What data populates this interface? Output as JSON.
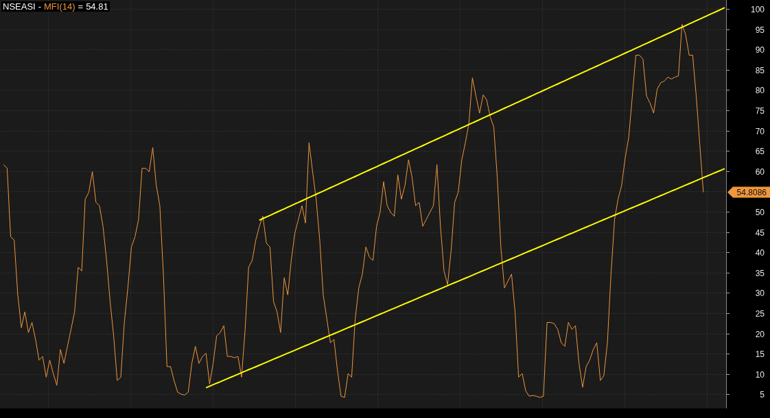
{
  "chart": {
    "title": {
      "symbol": "NSEASI",
      "separator": "-",
      "equals": "=",
      "value": "54.81"
    },
    "last_value": "54.8086",
    "chart_data": {
      "type": "line",
      "ylim": [
        1.5,
        102.2
      ],
      "grid": true,
      "yticks": [
        5,
        10,
        15,
        20,
        25,
        30,
        35,
        40,
        45,
        50,
        60,
        65,
        70,
        75,
        80,
        85,
        90,
        95,
        100
      ],
      "series": [
        {
          "name": "MFI(14)",
          "color": "#f0963c",
          "values": [
            61.6,
            60.7,
            43.8,
            43.0,
            29.5,
            21.4,
            25.3,
            20.2,
            22.7,
            18.5,
            13.4,
            14.3,
            9.2,
            13.4,
            10.1,
            7.2,
            16.0,
            12.6,
            16.8,
            21.0,
            25.3,
            36.3,
            35.4,
            53.1,
            54.8,
            59.9,
            52.3,
            51.5,
            46.4,
            38.0,
            27.8,
            19.4,
            8.4,
            9.2,
            22.7,
            31.2,
            41.3,
            43.8,
            48.1,
            60.7,
            60.7,
            59.9,
            65.8,
            56.5,
            51.5,
            34.6,
            11.8,
            11.8,
            8.4,
            5.5,
            5.0,
            4.8,
            5.5,
            12.6,
            16.8,
            12.6,
            14.3,
            15.1,
            7.5,
            12.6,
            19.4,
            20.2,
            21.9,
            14.3,
            14.3,
            14.0,
            14.3,
            9.2,
            21.0,
            36.3,
            38.0,
            43.0,
            46.4,
            48.9,
            42.2,
            41.3,
            27.8,
            25.3,
            20.2,
            33.7,
            29.5,
            38.0,
            44.7,
            48.1,
            51.5,
            47.2,
            67.0,
            59.9,
            53.1,
            43.0,
            29.5,
            23.6,
            17.7,
            18.5,
            10.9,
            4.5,
            4.2,
            10.1,
            9.2,
            23.6,
            31.2,
            34.6,
            41.3,
            38.8,
            38.0,
            46.4,
            49.8,
            57.4,
            51.5,
            49.8,
            48.9,
            59.1,
            53.1,
            56.5,
            62.8,
            58.5,
            51.5,
            52.3,
            46.4,
            48.1,
            49.8,
            51.5,
            61.6,
            46.4,
            35.4,
            32.0,
            40.5,
            52.3,
            54.8,
            62.8,
            67.0,
            71.7,
            83.0,
            78.5,
            74.3,
            78.8,
            77.6,
            73.4,
            70.9,
            58.2,
            41.3,
            31.2,
            32.9,
            34.6,
            25.3,
            9.2,
            10.1,
            5.8,
            4.5,
            4.7,
            4.5,
            4.2,
            4.5,
            22.7,
            22.7,
            22.4,
            21.0,
            17.7,
            16.8,
            22.7,
            21.0,
            21.9,
            12.6,
            6.7,
            11.8,
            13.4,
            16.0,
            17.7,
            8.4,
            9.6,
            17.7,
            34.6,
            48.1,
            53.1,
            56.5,
            63.3,
            68.4,
            78.5,
            88.6,
            88.6,
            87.6,
            78.5,
            76.8,
            74.3,
            80.2,
            81.8,
            82.2,
            83.2,
            82.7,
            83.2,
            83.5,
            96.2,
            93.7,
            88.6,
            88.6,
            78.5,
            66.6,
            54.8,
            null,
            null,
            null,
            null,
            null,
            null
          ]
        },
        {
          "color": "#ffff00",
          "values": [
            null,
            null,
            null,
            null,
            null,
            null,
            null,
            null,
            null,
            null,
            null,
            null,
            null,
            null,
            null,
            null,
            null,
            null,
            null,
            null,
            null,
            null,
            null,
            null,
            null,
            null,
            null,
            null,
            null,
            null,
            null,
            null,
            null,
            null,
            null,
            null,
            null,
            null,
            null,
            null,
            null,
            null,
            null,
            null,
            null,
            null,
            null,
            null,
            null,
            null,
            null,
            null,
            null,
            null,
            null,
            null,
            null,
            null,
            null,
            null,
            null,
            null,
            null,
            null,
            null,
            null,
            null,
            null,
            null,
            null,
            null,
            null,
            47.9,
            48.3,
            48.7,
            49.1,
            49.5,
            49.9,
            50.3,
            50.7,
            51.1,
            51.5,
            51.9,
            52.3,
            52.7,
            53.1,
            53.5,
            53.9,
            54.3,
            54.7,
            55.1,
            55.5,
            55.9,
            56.3,
            56.7,
            57.1,
            57.5,
            57.9,
            58.3,
            58.7,
            59.1,
            59.5,
            59.9,
            60.3,
            60.7,
            61.1,
            61.5,
            61.9,
            62.3,
            62.7,
            63.1,
            63.5,
            63.9,
            64.3,
            64.7,
            65.1,
            65.5,
            65.9,
            66.3,
            66.7,
            67.1,
            67.5,
            67.9,
            68.3,
            68.7,
            69.1,
            69.5,
            69.9,
            70.3,
            70.7,
            71.1,
            71.5,
            71.9,
            72.3,
            72.7,
            73.1,
            73.5,
            73.9,
            74.3,
            74.7,
            75.1,
            75.5,
            75.9,
            76.3,
            76.7,
            77.1,
            77.5,
            77.9,
            78.3,
            78.7,
            79.1,
            79.5,
            79.9,
            80.3,
            80.7,
            81.1,
            81.5,
            81.9,
            82.3,
            82.7,
            83.1,
            83.5,
            83.9,
            84.3,
            84.7,
            85.1,
            85.5,
            85.9,
            86.3,
            86.7,
            87.1,
            87.5,
            87.9,
            88.3,
            88.7,
            89.1,
            89.5,
            89.9,
            90.3,
            90.7,
            91.1,
            91.5,
            91.9,
            92.3,
            92.7,
            93.1,
            93.5,
            93.9,
            94.3,
            94.7,
            95.1,
            95.5,
            95.9,
            96.3,
            96.7,
            97.1,
            97.5,
            97.9,
            98.3,
            98.7,
            99.1,
            99.5,
            99.9,
            100.3
          ]
        },
        {
          "color": "#ffff00",
          "values": [
            null,
            null,
            null,
            null,
            null,
            null,
            null,
            null,
            null,
            null,
            null,
            null,
            null,
            null,
            null,
            null,
            null,
            null,
            null,
            null,
            null,
            null,
            null,
            null,
            null,
            null,
            null,
            null,
            null,
            null,
            null,
            null,
            null,
            null,
            null,
            null,
            null,
            null,
            null,
            null,
            null,
            null,
            null,
            null,
            null,
            null,
            null,
            null,
            null,
            null,
            null,
            null,
            null,
            null,
            null,
            null,
            null,
            6.6,
            6.97,
            7.34,
            7.71,
            8.08,
            8.45,
            8.82,
            9.19,
            9.56,
            9.93,
            10.3,
            10.67,
            11.04,
            11.41,
            11.78,
            12.15,
            12.52,
            12.89,
            13.26,
            13.63,
            14,
            14.37,
            14.74,
            15.11,
            15.48,
            15.85,
            16.22,
            16.59,
            16.96,
            17.33,
            17.7,
            18.07,
            18.44,
            18.81,
            19.18,
            19.55,
            19.92,
            20.29,
            20.66,
            21.03,
            21.4,
            21.77,
            22.14,
            22.51,
            22.88,
            23.25,
            23.62,
            23.99,
            24.36,
            24.73,
            25.1,
            25.47,
            25.84,
            26.21,
            26.58,
            26.95,
            27.32,
            27.69,
            28.06,
            28.43,
            28.8,
            29.17,
            29.54,
            29.91,
            30.28,
            30.65,
            31.02,
            31.39,
            31.76,
            32.13,
            32.5,
            32.87,
            33.24,
            33.61,
            33.98,
            34.35,
            34.72,
            35.09,
            35.46,
            35.83,
            36.2,
            36.57,
            36.94,
            37.31,
            37.68,
            38.05,
            38.42,
            38.79,
            39.16,
            39.53,
            39.9,
            40.27,
            40.64,
            41.01,
            41.38,
            41.75,
            42.12,
            42.49,
            42.86,
            43.23,
            43.6,
            43.97,
            44.34,
            44.71,
            45.08,
            45.45,
            45.82,
            46.19,
            46.56,
            46.93,
            47.3,
            47.67,
            48.04,
            48.41,
            48.78,
            49.15,
            49.52,
            49.89,
            50.26,
            50.63,
            51,
            51.37,
            51.74,
            52.11,
            52.48,
            52.85,
            53.22,
            53.59,
            53.96,
            54.33,
            54.7,
            55.07,
            55.44,
            55.81,
            56.18,
            56.55,
            56.92,
            57.29,
            57.66,
            58.03,
            58.4,
            58.77,
            59.14,
            59.51,
            59.88,
            60.25,
            60.62
          ]
        }
      ]
    }
  }
}
